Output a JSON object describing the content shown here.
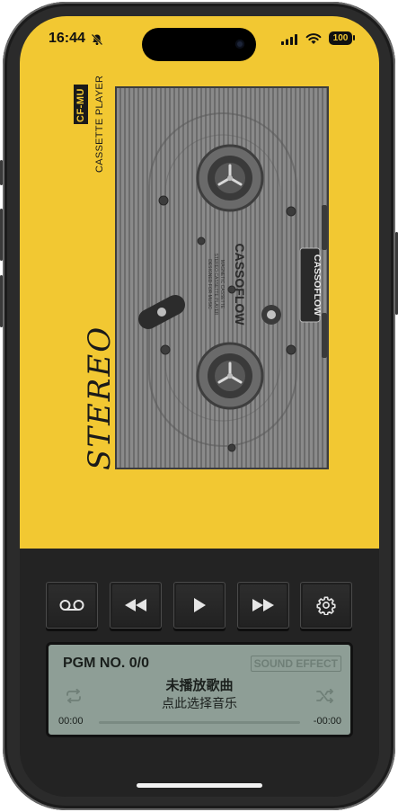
{
  "status_bar": {
    "time": "16:44",
    "battery": "100",
    "icons": [
      "bell-slash-icon",
      "signal-icon",
      "wifi-icon",
      "battery-icon"
    ]
  },
  "cassette": {
    "model": "CF-MU",
    "type_label": "CASSETTE PLAYER",
    "stereo_label": "STEREO",
    "brand": "CASSOFLOW",
    "badge": "CASSOFLOW",
    "spec_lines": [
      "MAGNETIC CASSETTE",
      "STEREO CASSETTE PLAYER",
      "DESIGNED FOR MUSIC"
    ]
  },
  "controls": [
    {
      "name": "cassette-button",
      "icon": "tape-icon"
    },
    {
      "name": "rewind-button",
      "icon": "rewind-icon"
    },
    {
      "name": "play-button",
      "icon": "play-icon"
    },
    {
      "name": "fast-forward-button",
      "icon": "fast-forward-icon"
    },
    {
      "name": "settings-button",
      "icon": "gear-icon"
    }
  ],
  "display": {
    "program": "PGM NO. 0/0",
    "sound_effect": "SOUND EFFECT",
    "song_title": "未播放歌曲",
    "song_subtitle": "点此选择音乐",
    "time_elapsed": "00:00",
    "time_remaining": "-00:00",
    "progress": 0
  },
  "colors": {
    "body": "#f2c832",
    "panel": "#232323",
    "lcd": "#8e9e96"
  }
}
